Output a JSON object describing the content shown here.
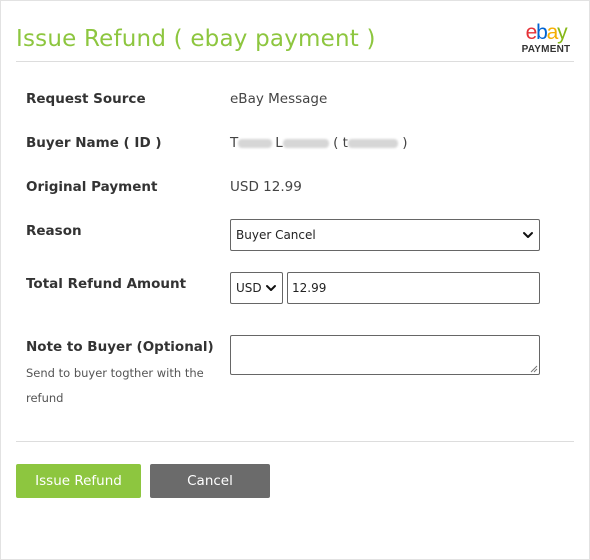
{
  "dialog": {
    "title": "Issue Refund ( ebay payment )",
    "logo": {
      "letters": [
        "e",
        "b",
        "a",
        "y"
      ],
      "letter_colors": [
        "#e53238",
        "#0064d2",
        "#f5af02",
        "#86b817"
      ],
      "subtitle": "PAYMENT"
    },
    "accent_color": "#8dc63f"
  },
  "fields": {
    "request_source": {
      "label": "Request Source",
      "value": "eBay Message"
    },
    "buyer_name": {
      "label": "Buyer Name ( ID )",
      "value_prefix_1": "T",
      "value_prefix_2": "L",
      "value_open": "( t",
      "value_close": ")"
    },
    "original_payment": {
      "label": "Original Payment",
      "value": "USD 12.99"
    },
    "reason": {
      "label": "Reason",
      "selected": "Buyer Cancel"
    },
    "total_refund": {
      "label": "Total Refund Amount",
      "currency": "USD",
      "amount": "12.99"
    },
    "note": {
      "label": "Note to Buyer (Optional)",
      "hint": "Send to buyer togther with the refund",
      "value": ""
    }
  },
  "buttons": {
    "issue_refund": "Issue Refund",
    "cancel": "Cancel"
  }
}
